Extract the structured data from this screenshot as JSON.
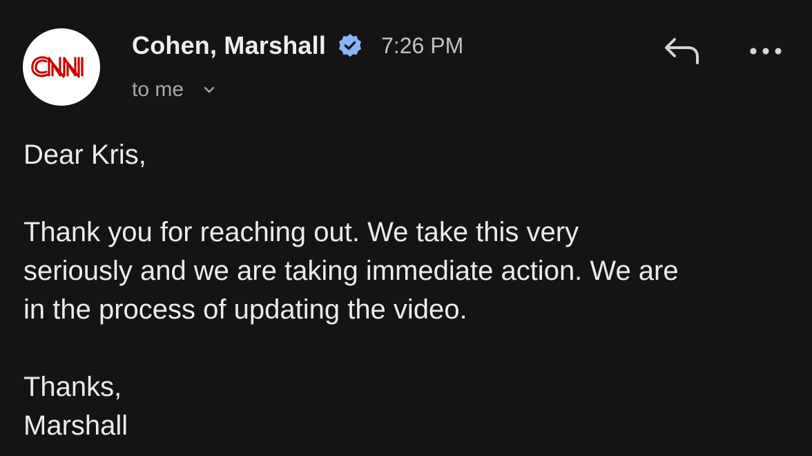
{
  "email": {
    "sender_avatar": {
      "icon": "cnn-logo-icon",
      "logo_text": "CNN",
      "logo_color": "#cc0000",
      "background": "#ffffff"
    },
    "sender_name": "Cohen, Marshall",
    "verified_icon": "verified-badge-icon",
    "verified_color": "#8ab4f8",
    "time": "7:26 PM",
    "recipient_label": "to me",
    "actions": {
      "reply_icon": "reply-icon",
      "more_icon": "more-options-icon"
    },
    "body": {
      "greeting": "Dear Kris,",
      "paragraph": "Thank you for reaching out.  We take this very\nseriously and we are taking immediate action. We are\nin the process of updating the video.",
      "closing": "Thanks,",
      "signature": "Marshall"
    }
  }
}
